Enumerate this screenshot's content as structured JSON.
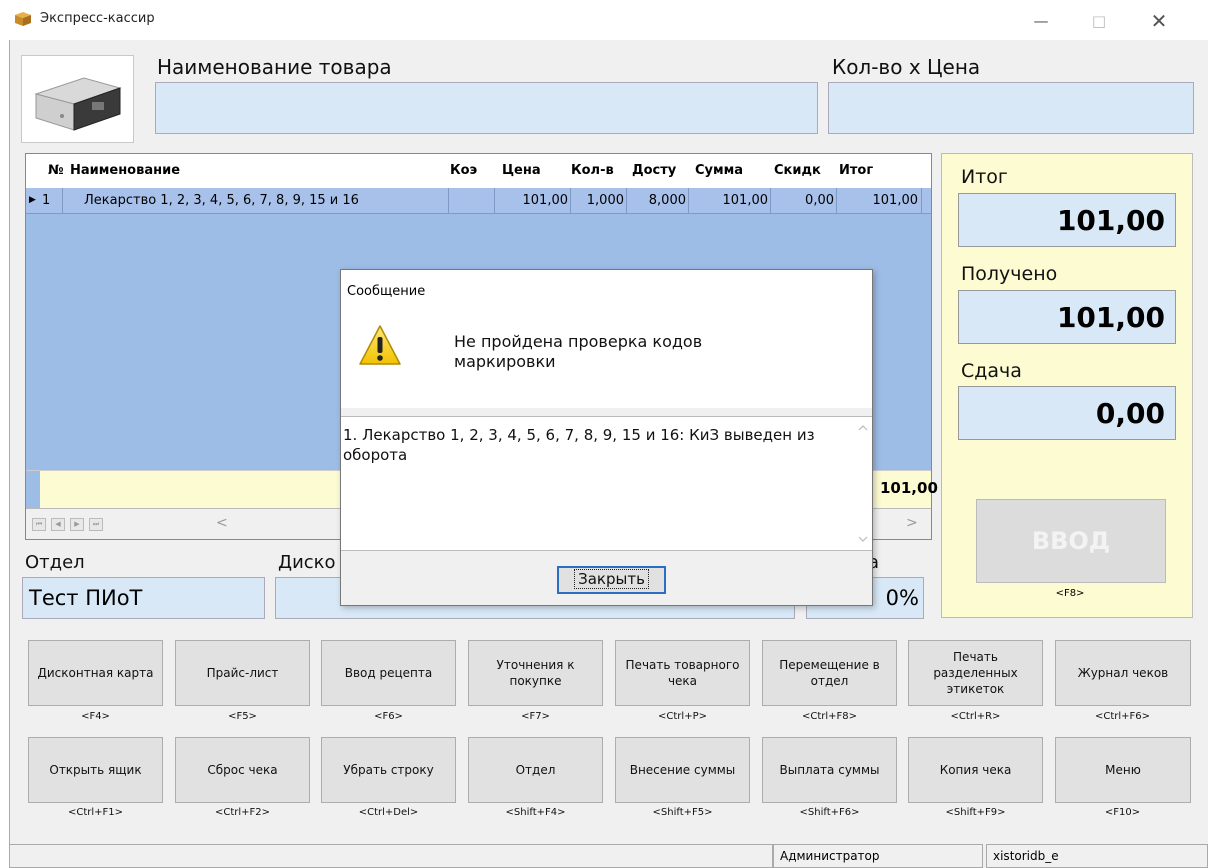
{
  "window": {
    "title": "Экспресс-кассир",
    "minimize": "—",
    "maximize": "□",
    "close": "✕",
    "icon": "app-box-icon"
  },
  "header": {
    "name_label": "Наименование товара",
    "qty_label": "Кол-во х Цена",
    "name_value": "",
    "qty_value": ""
  },
  "grid": {
    "columns": [
      "№",
      "Наименование",
      "Коэ",
      "Цена",
      "Кол-в",
      "Досту",
      "Сумма",
      "Скидк",
      "Итог"
    ],
    "row": {
      "pointer": "▶",
      "num": "1",
      "name": "Лекарство 1, 2, 3, 4, 5, 6, 7, 8, 9, 15 и 16",
      "coef": "",
      "price": "101,00",
      "qty": "1,000",
      "available": "8,000",
      "sum": "101,00",
      "discount": "0,00",
      "total": "101,00"
    },
    "footer_total": "101,00",
    "nav": [
      "⏮",
      "◀",
      "▶",
      "⏭"
    ],
    "scroll_left": "<",
    "scroll_right": ">"
  },
  "totals": {
    "itog_label": "Итог",
    "itog_value": "101,00",
    "received_label": "Получено",
    "received_value": "101,00",
    "change_label": "Сдача",
    "change_value": "0,00",
    "enter_label": "ВВОД",
    "enter_key": "<F8>"
  },
  "dept": {
    "label": "Отдел",
    "value": "Тест ПИоТ",
    "discount_label": "Диско",
    "discount_value": "",
    "pct_label": "а",
    "pct_value": "0%"
  },
  "buttons_row1": [
    {
      "label": "Дисконтная карта",
      "key": "<F4>"
    },
    {
      "label": "Прайс-лист",
      "key": "<F5>"
    },
    {
      "label": "Ввод рецепта",
      "key": "<F6>"
    },
    {
      "label": "Уточнения к покупке",
      "key": "<F7>"
    },
    {
      "label": "Печать товарного чека",
      "key": "<Ctrl+P>"
    },
    {
      "label": "Перемещение в отдел",
      "key": "<Ctrl+F8>"
    },
    {
      "label": "Печать разделенных этикеток",
      "key": "<Ctrl+R>"
    },
    {
      "label": "Журнал чеков",
      "key": "<Ctrl+F6>"
    }
  ],
  "buttons_row2": [
    {
      "label": "Открыть ящик",
      "key": "<Ctrl+F1>"
    },
    {
      "label": "Сброс чека",
      "key": "<Ctrl+F2>"
    },
    {
      "label": "Убрать строку",
      "key": "<Ctrl+Del>"
    },
    {
      "label": "Отдел",
      "key": "<Shift+F4>"
    },
    {
      "label": "Внесение суммы",
      "key": "<Shift+F5>"
    },
    {
      "label": "Выплата суммы",
      "key": "<Shift+F6>"
    },
    {
      "label": "Копия чека",
      "key": "<Shift+F9>"
    },
    {
      "label": "Меню",
      "key": "<F10>"
    }
  ],
  "status": {
    "user": "Администратор",
    "db": "xistoridb_e"
  },
  "dialog": {
    "title": "Сообщение",
    "message": "Не пройдена проверка кодов маркировки",
    "details": "1. Лекарство 1, 2, 3, 4, 5, 6, 7, 8, 9, 15 и 16: КиЗ выведен из оборота",
    "close_button": "Закрыть",
    "icon": "warning-icon"
  },
  "colors": {
    "grid_bg": "#9ebde6",
    "panel_bg": "#fdfbd2",
    "field_bg": "#d8e8f6",
    "focus_border": "#2d6ec2"
  }
}
